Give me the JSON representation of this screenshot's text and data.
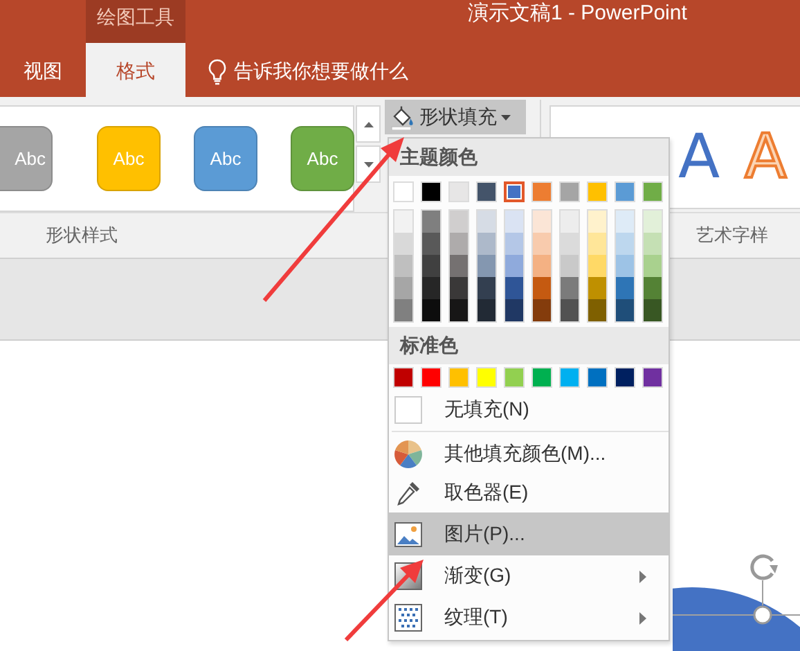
{
  "window": {
    "title": "演示文稿1  -  PowerPoint"
  },
  "contextual_group": {
    "label": "绘图工具"
  },
  "tabs": [
    {
      "label": "视图",
      "selected": false
    },
    {
      "label": "格式",
      "selected": true
    }
  ],
  "tell_me": {
    "label": "告诉我你想要做什么"
  },
  "shape_styles": {
    "group_label": "形状样式",
    "items": [
      {
        "label": "Abc",
        "color": "#a5a5a5"
      },
      {
        "label": "Abc",
        "color": "#ffc000"
      },
      {
        "label": "Abc",
        "color": "#5b9bd5"
      },
      {
        "label": "Abc",
        "color": "#70ad47"
      }
    ]
  },
  "shape_fill_button": {
    "label": "形状填充",
    "expanded": true
  },
  "wordart_styles": {
    "group_label": "艺术字样",
    "items": [
      {
        "label": "A",
        "kind": "blue-fill"
      },
      {
        "label": "A",
        "kind": "orange-outline"
      }
    ]
  },
  "fill_menu": {
    "theme_header": "主题颜色",
    "standard_header": "标准色",
    "theme_colors": [
      {
        "color": "#ffffff",
        "selected": false,
        "shades": [
          {
            "color": "#f2f2f2"
          },
          {
            "color": "#d9d9d9"
          },
          {
            "color": "#bfbfbf"
          },
          {
            "color": "#a6a6a6"
          },
          {
            "color": "#808080"
          }
        ]
      },
      {
        "color": "#000000",
        "selected": false,
        "shades": [
          {
            "color": "#7f7f7f"
          },
          {
            "color": "#595959"
          },
          {
            "color": "#404040"
          },
          {
            "color": "#262626"
          },
          {
            "color": "#0d0d0d"
          }
        ]
      },
      {
        "color": "#e7e6e6",
        "selected": false,
        "shades": [
          {
            "color": "#d0cece"
          },
          {
            "color": "#aeabab"
          },
          {
            "color": "#757171"
          },
          {
            "color": "#3a3838"
          },
          {
            "color": "#171616"
          }
        ]
      },
      {
        "color": "#44546a",
        "selected": false,
        "shades": [
          {
            "color": "#d6dce5"
          },
          {
            "color": "#adb9ca"
          },
          {
            "color": "#8497b0"
          },
          {
            "color": "#333f50"
          },
          {
            "color": "#222a35"
          }
        ]
      },
      {
        "color": "#4472c4",
        "selected": true,
        "shades": [
          {
            "color": "#dae3f3"
          },
          {
            "color": "#b4c7e7"
          },
          {
            "color": "#8faadc"
          },
          {
            "color": "#2f5597"
          },
          {
            "color": "#203864"
          }
        ]
      },
      {
        "color": "#ed7d31",
        "selected": false,
        "shades": [
          {
            "color": "#fbe5d6"
          },
          {
            "color": "#f8cbad"
          },
          {
            "color": "#f4b183"
          },
          {
            "color": "#c55a11"
          },
          {
            "color": "#843c0c"
          }
        ]
      },
      {
        "color": "#a5a5a5",
        "selected": false,
        "shades": [
          {
            "color": "#ededed"
          },
          {
            "color": "#dbdbdb"
          },
          {
            "color": "#c9c9c9"
          },
          {
            "color": "#7b7b7b"
          },
          {
            "color": "#525252"
          }
        ]
      },
      {
        "color": "#ffc000",
        "selected": false,
        "shades": [
          {
            "color": "#fff2cc"
          },
          {
            "color": "#ffe699"
          },
          {
            "color": "#ffd966"
          },
          {
            "color": "#bf9000"
          },
          {
            "color": "#7f6000"
          }
        ]
      },
      {
        "color": "#5b9bd5",
        "selected": false,
        "shades": [
          {
            "color": "#deebf7"
          },
          {
            "color": "#bdd7ee"
          },
          {
            "color": "#9dc3e6"
          },
          {
            "color": "#2e75b6"
          },
          {
            "color": "#1f4e79"
          }
        ]
      },
      {
        "color": "#70ad47",
        "selected": false,
        "shades": [
          {
            "color": "#e2f0d9"
          },
          {
            "color": "#c5e0b4"
          },
          {
            "color": "#a9d18e"
          },
          {
            "color": "#548235"
          },
          {
            "color": "#385723"
          }
        ]
      }
    ],
    "standard_colors": [
      {
        "color": "#c00000"
      },
      {
        "color": "#ff0000"
      },
      {
        "color": "#ffc000"
      },
      {
        "color": "#ffff00"
      },
      {
        "color": "#92d050"
      },
      {
        "color": "#00b050"
      },
      {
        "color": "#00b0f0"
      },
      {
        "color": "#0070c0"
      },
      {
        "color": "#002060"
      },
      {
        "color": "#7030a0"
      }
    ],
    "items": [
      {
        "kind": "no-fill",
        "label": "无填充(N)",
        "selected": false,
        "submenu": false
      },
      {
        "kind": "more-colors",
        "label": "其他填充颜色(M)...",
        "selected": false,
        "submenu": false
      },
      {
        "kind": "eyedropper",
        "label": "取色器(E)",
        "selected": false,
        "submenu": false
      },
      {
        "kind": "picture",
        "label": "图片(P)...",
        "selected": true,
        "submenu": false
      },
      {
        "kind": "gradient",
        "label": "渐变(G)",
        "selected": false,
        "submenu": true
      },
      {
        "kind": "texture",
        "label": "纹理(T)",
        "selected": false,
        "submenu": true
      }
    ]
  }
}
